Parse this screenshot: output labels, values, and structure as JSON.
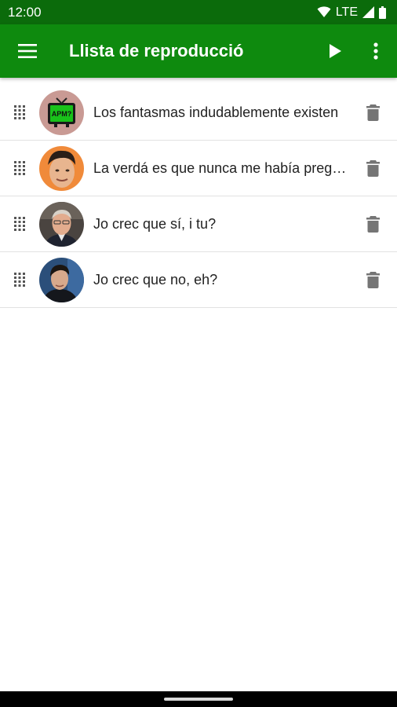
{
  "status_bar": {
    "time": "12:00",
    "network": "LTE",
    "icons": [
      "wifi-icon",
      "signal-icon",
      "battery-icon"
    ]
  },
  "app_bar": {
    "title": "Llista de reproducció",
    "icons": [
      "menu-icon",
      "play-icon",
      "more-vert-icon"
    ],
    "color": "#0e8a0e"
  },
  "playlist": {
    "items": [
      {
        "text": "Los fantasmas indudablemente existen",
        "avatar": "tv-apm-logo"
      },
      {
        "text": "La verdá es que nunca me había preguntado",
        "avatar": "person-photo"
      },
      {
        "text": "Jo crec que sí, i tu?",
        "avatar": "person-photo"
      },
      {
        "text": "Jo crec que no, eh?",
        "avatar": "person-photo"
      }
    ],
    "row_icons": [
      "drag-handle-icon",
      "delete-icon"
    ]
  },
  "logo_text": "APM?"
}
